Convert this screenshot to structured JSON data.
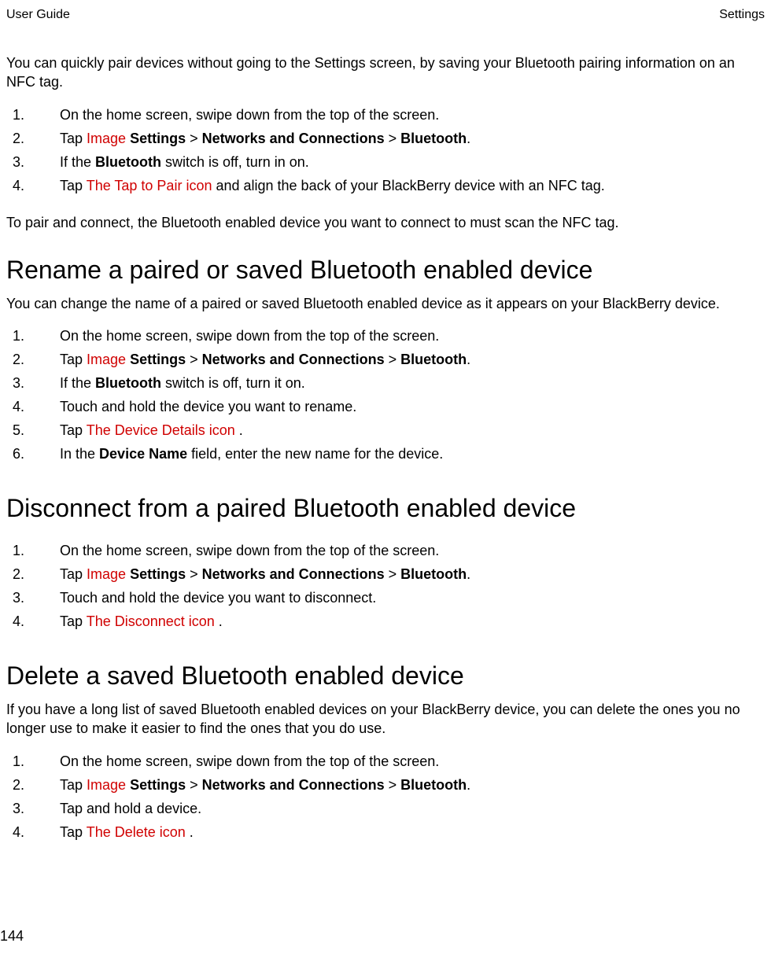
{
  "header": {
    "left": "User Guide",
    "right": "Settings"
  },
  "footer": {
    "pageNum": "144"
  },
  "section0": {
    "intro": "You can quickly pair devices without going to the Settings screen, by saving your Bluetooth pairing information on an NFC tag.",
    "steps": [
      {
        "num": "1.",
        "parts": [
          {
            "t": "On the home screen, swipe down from the top of the screen."
          }
        ]
      },
      {
        "num": "2.",
        "parts": [
          {
            "t": "Tap  "
          },
          {
            "t": "Image",
            "red": true
          },
          {
            "t": "  "
          },
          {
            "t": "Settings",
            "bold": true
          },
          {
            "t": " > "
          },
          {
            "t": "Networks and Connections",
            "bold": true
          },
          {
            "t": " > "
          },
          {
            "t": "Bluetooth",
            "bold": true
          },
          {
            "t": "."
          }
        ]
      },
      {
        "num": "3.",
        "parts": [
          {
            "t": "If the "
          },
          {
            "t": "Bluetooth",
            "bold": true
          },
          {
            "t": " switch is off, turn in on."
          }
        ]
      },
      {
        "num": "4.",
        "parts": [
          {
            "t": "Tap  "
          },
          {
            "t": "The Tap to Pair icon",
            "red": true
          },
          {
            "t": "  and align the back of your BlackBerry device with an NFC tag."
          }
        ]
      }
    ],
    "after": "To pair and connect, the Bluetooth enabled device you want to connect to must scan the NFC tag."
  },
  "section1": {
    "title": "Rename a paired or saved Bluetooth enabled device",
    "intro": "You can change the name of a paired or saved Bluetooth enabled device as it appears on your BlackBerry device.",
    "steps": [
      {
        "num": "1.",
        "parts": [
          {
            "t": "On the home screen, swipe down from the top of the screen."
          }
        ]
      },
      {
        "num": "2.",
        "parts": [
          {
            "t": "Tap  "
          },
          {
            "t": "Image",
            "red": true
          },
          {
            "t": "  "
          },
          {
            "t": "Settings",
            "bold": true
          },
          {
            "t": " > "
          },
          {
            "t": "Networks and Connections",
            "bold": true
          },
          {
            "t": " > "
          },
          {
            "t": "Bluetooth",
            "bold": true
          },
          {
            "t": "."
          }
        ]
      },
      {
        "num": "3.",
        "parts": [
          {
            "t": "If the "
          },
          {
            "t": "Bluetooth",
            "bold": true
          },
          {
            "t": " switch is off, turn it on."
          }
        ]
      },
      {
        "num": "4.",
        "parts": [
          {
            "t": "Touch and hold the device you want to rename."
          }
        ]
      },
      {
        "num": "5.",
        "parts": [
          {
            "t": "Tap  "
          },
          {
            "t": "The Device Details icon",
            "red": true
          },
          {
            "t": " ."
          }
        ]
      },
      {
        "num": "6.",
        "parts": [
          {
            "t": "In the "
          },
          {
            "t": "Device Name",
            "bold": true
          },
          {
            "t": " field, enter the new name for the device."
          }
        ]
      }
    ]
  },
  "section2": {
    "title": "Disconnect from a paired Bluetooth enabled device",
    "steps": [
      {
        "num": "1.",
        "parts": [
          {
            "t": "On the home screen, swipe down from the top of the screen."
          }
        ]
      },
      {
        "num": "2.",
        "parts": [
          {
            "t": "Tap  "
          },
          {
            "t": "Image",
            "red": true
          },
          {
            "t": "  "
          },
          {
            "t": "Settings",
            "bold": true
          },
          {
            "t": " > "
          },
          {
            "t": "Networks and Connections",
            "bold": true
          },
          {
            "t": " > "
          },
          {
            "t": "Bluetooth",
            "bold": true
          },
          {
            "t": "."
          }
        ]
      },
      {
        "num": "3.",
        "parts": [
          {
            "t": "Touch and hold the device you want to disconnect."
          }
        ]
      },
      {
        "num": "4.",
        "parts": [
          {
            "t": "Tap  "
          },
          {
            "t": "The Disconnect icon",
            "red": true
          },
          {
            "t": " ."
          }
        ]
      }
    ]
  },
  "section3": {
    "title": "Delete a saved Bluetooth enabled device",
    "intro": "If you have a long list of saved Bluetooth enabled devices on your BlackBerry device, you can delete the ones you no longer use to make it easier to find the ones that you do use.",
    "steps": [
      {
        "num": "1.",
        "parts": [
          {
            "t": "On the home screen, swipe down from the top of the screen."
          }
        ]
      },
      {
        "num": "2.",
        "parts": [
          {
            "t": "Tap  "
          },
          {
            "t": "Image",
            "red": true
          },
          {
            "t": "  "
          },
          {
            "t": "Settings",
            "bold": true
          },
          {
            "t": " > "
          },
          {
            "t": "Networks and Connections",
            "bold": true
          },
          {
            "t": " > "
          },
          {
            "t": "Bluetooth",
            "bold": true
          },
          {
            "t": "."
          }
        ]
      },
      {
        "num": "3.",
        "parts": [
          {
            "t": "Tap and hold a device."
          }
        ]
      },
      {
        "num": "4.",
        "parts": [
          {
            "t": "Tap  "
          },
          {
            "t": "The Delete icon",
            "red": true
          },
          {
            "t": " ."
          }
        ]
      }
    ]
  }
}
